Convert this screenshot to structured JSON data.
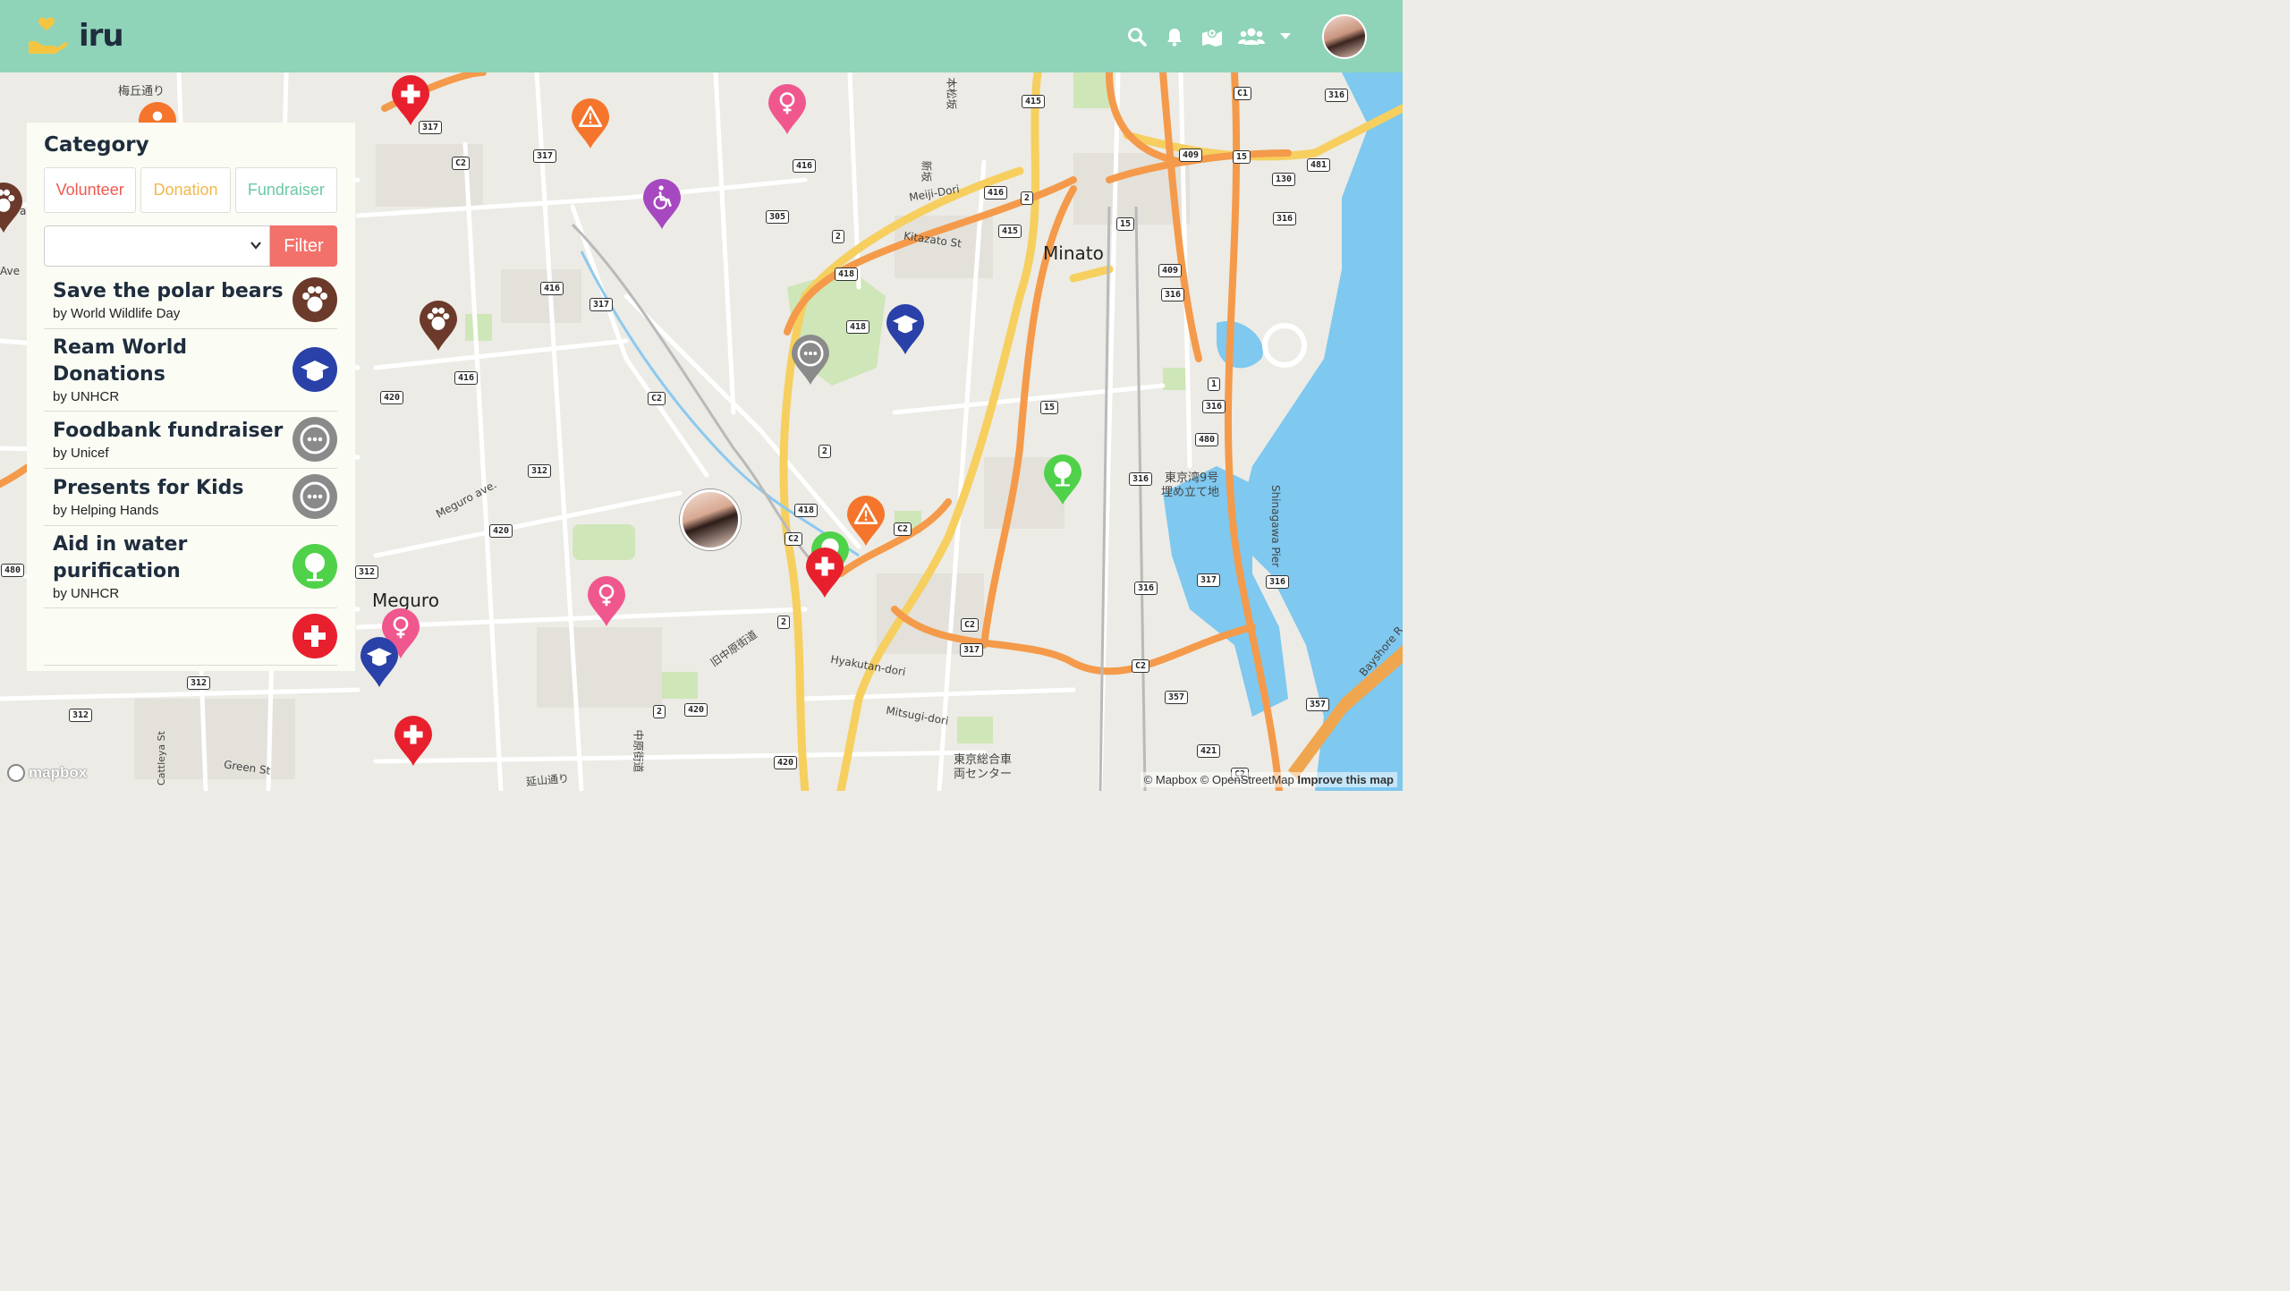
{
  "app": {
    "name": "iru"
  },
  "nav": {
    "icons": [
      "search-icon",
      "bell-icon",
      "map-icon",
      "users-icon",
      "caret-down-icon"
    ]
  },
  "sidebar": {
    "title": "Category",
    "categories": [
      {
        "label": "Volunteer",
        "color": "#ef5a4f"
      },
      {
        "label": "Donation",
        "color": "#f1b94a"
      },
      {
        "label": "Fundraiser",
        "color": "#6cc9a5"
      }
    ],
    "select_value": "",
    "filter_label": "Filter",
    "events": [
      {
        "title": "Save the polar bears",
        "by": "by World Wildlife Day",
        "icon": "paw-icon",
        "color": "#6b3a2a"
      },
      {
        "title": "Ream World Donations",
        "by": "by UNHCR",
        "icon": "graduation-cap-icon",
        "color": "#2941a8"
      },
      {
        "title": "Foodbank fundraiser",
        "by": "by Unicef",
        "icon": "ellipsis-icon",
        "color": "#8a8a8a"
      },
      {
        "title": "Presents for Kids",
        "by": "by Helping Hands",
        "icon": "ellipsis-icon",
        "color": "#8a8a8a"
      },
      {
        "title": "Aid in water purification",
        "by": "by UNHCR",
        "icon": "tree-icon",
        "color": "#4fd14a"
      }
    ]
  },
  "map": {
    "labels": {
      "minato": "Minato",
      "meguro": "Meguro",
      "umegaoka": "梅丘通り",
      "meiji_dori": "Meiji-Dori",
      "kitazato": "Kitazato St",
      "meguro_ave": "Meguro ave.",
      "hyakutan": "Hyakutan-dori",
      "mitsugi": "Mitsugi-dori",
      "green_st": "Green St",
      "cattleya": "Cattleya St",
      "shinagawa_pier": "Shinagawa Pier",
      "bayshore": "Bayshore R",
      "tokyo_bay9": "東京湾9号",
      "umetate": "埋め立て地",
      "tokyo_center1": "東京総合車",
      "tokyo_center2": "両センター",
      "kyu_nakahara": "旧中原街道",
      "nakahara": "中原街道",
      "enzan": "延山通り",
      "honmatsu": "本松坂",
      "shinzaka": "新坂",
      "ave": "Ave",
      "a": "a"
    },
    "shields": [
      "317",
      "317",
      "C2",
      "416",
      "305",
      "416",
      "2",
      "415",
      "415",
      "2",
      "C1",
      "316",
      "409",
      "15",
      "481",
      "130",
      "316",
      "15",
      "418",
      "418",
      "409",
      "316",
      "416",
      "317",
      "416",
      "420",
      "C2",
      "1",
      "316",
      "15",
      "480",
      "316",
      "312",
      "420",
      "2",
      "418",
      "C2",
      "317",
      "316",
      "316",
      "480",
      "312",
      "312",
      "312",
      "2",
      "C2",
      "317",
      "C2",
      "C2",
      "357",
      "357",
      "421",
      "420",
      "2",
      "420",
      "C2"
    ],
    "attribution": {
      "mapbox": "© Mapbox",
      "osm": "© OpenStreetMap",
      "improve": "Improve this map"
    },
    "logo": "mapbox"
  },
  "colors": {
    "navbar": "#8fd4b8",
    "red": "#e8202e",
    "orange": "#f4752b",
    "pink": "#f0578f",
    "purple": "#a649c0",
    "brown": "#6b3a2a",
    "blue": "#2941a8",
    "gray": "#8a8a8a",
    "green": "#4fd14a"
  }
}
